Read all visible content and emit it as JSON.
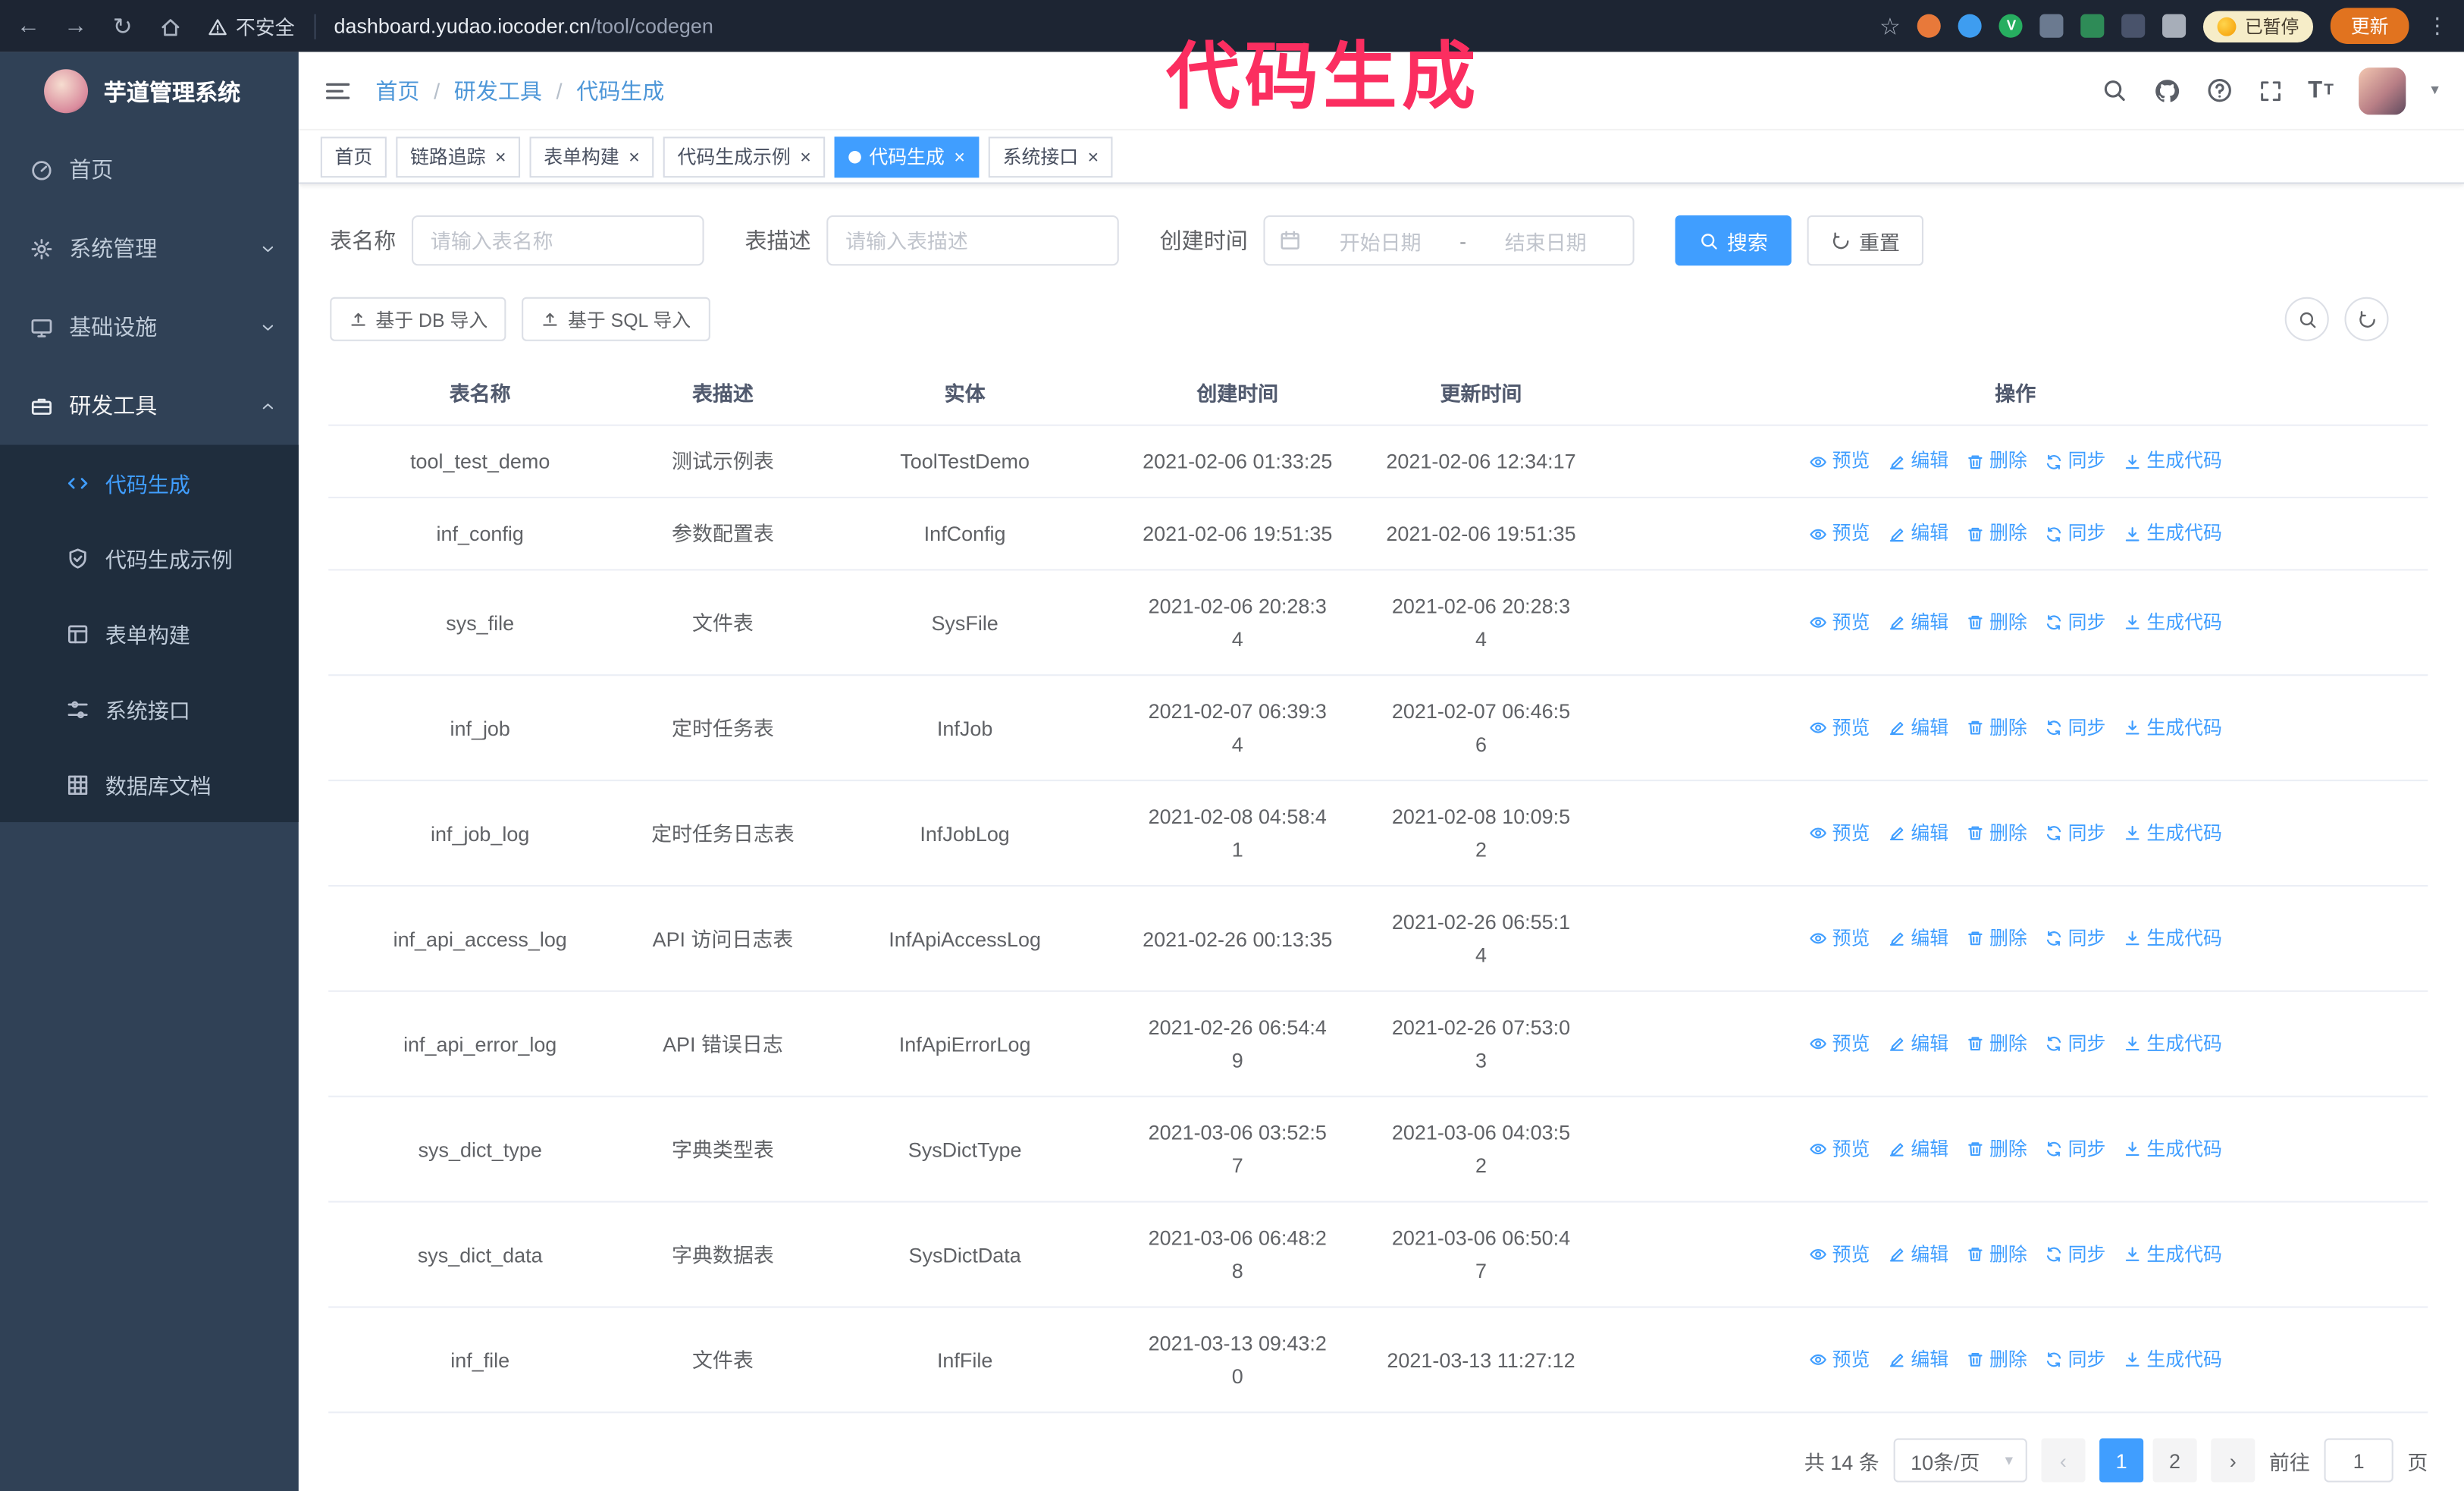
{
  "annotation": {
    "text": "代码生成"
  },
  "icons": {
    "back": "←",
    "forward": "→",
    "reload": "↻",
    "star": "☆",
    "kebab": "⋮",
    "caret": "▾",
    "close": "×",
    "prev": "‹",
    "next": "›"
  },
  "browser": {
    "security_label": "不安全",
    "url_host": "dashboard.yudao.iocoder.cn",
    "url_path": "/tool/codegen",
    "paused_badge": "已暂停",
    "update_label": "更新"
  },
  "sidebar": {
    "logo_title": "芋道管理系统",
    "menu": [
      {
        "label": "首页",
        "icon": "home",
        "kind": "leaf",
        "active": false,
        "expanded": false
      },
      {
        "label": "系统管理",
        "icon": "gear",
        "kind": "parent",
        "active": false,
        "expanded": false
      },
      {
        "label": "基础设施",
        "icon": "monitor",
        "kind": "parent",
        "active": false,
        "expanded": false
      },
      {
        "label": "研发工具",
        "icon": "tools",
        "kind": "parent",
        "active": false,
        "expanded": true,
        "children": [
          {
            "label": "代码生成",
            "icon": "code",
            "active": true
          },
          {
            "label": "代码生成示例",
            "icon": "shield",
            "active": false
          },
          {
            "label": "表单构建",
            "icon": "form",
            "active": false
          },
          {
            "label": "系统接口",
            "icon": "sliders",
            "active": false
          },
          {
            "label": "数据库文档",
            "icon": "grid",
            "active": false
          }
        ]
      }
    ]
  },
  "navbar": {
    "breadcrumb": [
      "首页",
      "研发工具",
      "代码生成"
    ]
  },
  "tags": [
    {
      "label": "首页",
      "closable": false,
      "active": false
    },
    {
      "label": "链路追踪",
      "closable": true,
      "active": false
    },
    {
      "label": "表单构建",
      "closable": true,
      "active": false
    },
    {
      "label": "代码生成示例",
      "closable": true,
      "active": false
    },
    {
      "label": "代码生成",
      "closable": true,
      "active": true
    },
    {
      "label": "系统接口",
      "closable": true,
      "active": false
    }
  ],
  "filters": {
    "table_name_label": "表名称",
    "table_name_placeholder": "请输入表名称",
    "table_desc_label": "表描述",
    "table_desc_placeholder": "请输入表描述",
    "create_time_label": "创建时间",
    "date_start_placeholder": "开始日期",
    "date_separator": "-",
    "date_end_placeholder": "结束日期",
    "search_label": "搜索",
    "reset_label": "重置"
  },
  "toolbar": {
    "import_db": "基于 DB 导入",
    "import_sql": "基于 SQL 导入"
  },
  "table": {
    "columns": [
      "表名称",
      "表描述",
      "实体",
      "创建时间",
      "更新时间",
      "操作"
    ],
    "action_labels": [
      "预览",
      "编辑",
      "删除",
      "同步",
      "生成代码"
    ],
    "rows": [
      {
        "name": "tool_test_demo",
        "desc": "测试示例表",
        "entity": "ToolTestDemo",
        "created": "2021-02-06 01:33:25",
        "updated": "2021-02-06 12:34:17"
      },
      {
        "name": "inf_config",
        "desc": "参数配置表",
        "entity": "InfConfig",
        "created": "2021-02-06 19:51:35",
        "updated": "2021-02-06 19:51:35"
      },
      {
        "name": "sys_file",
        "desc": "文件表",
        "entity": "SysFile",
        "created": "2021-02-06 20:28:3\n4",
        "updated": "2021-02-06 20:28:3\n4"
      },
      {
        "name": "inf_job",
        "desc": "定时任务表",
        "entity": "InfJob",
        "created": "2021-02-07 06:39:3\n4",
        "updated": "2021-02-07 06:46:5\n6"
      },
      {
        "name": "inf_job_log",
        "desc": "定时任务日志表",
        "entity": "InfJobLog",
        "created": "2021-02-08 04:58:4\n1",
        "updated": "2021-02-08 10:09:5\n2"
      },
      {
        "name": "inf_api_access_log",
        "desc": "API 访问日志表",
        "entity": "InfApiAccessLog",
        "created": "2021-02-26 00:13:35",
        "updated": "2021-02-26 06:55:1\n4"
      },
      {
        "name": "inf_api_error_log",
        "desc": "API 错误日志",
        "entity": "InfApiErrorLog",
        "created": "2021-02-26 06:54:4\n9",
        "updated": "2021-02-26 07:53:0\n3"
      },
      {
        "name": "sys_dict_type",
        "desc": "字典类型表",
        "entity": "SysDictType",
        "created": "2021-03-06 03:52:5\n7",
        "updated": "2021-03-06 04:03:5\n2"
      },
      {
        "name": "sys_dict_data",
        "desc": "字典数据表",
        "entity": "SysDictData",
        "created": "2021-03-06 06:48:2\n8",
        "updated": "2021-03-06 06:50:4\n7"
      },
      {
        "name": "inf_file",
        "desc": "文件表",
        "entity": "InfFile",
        "created": "2021-03-13 09:43:2\n0",
        "updated": "2021-03-13 11:27:12"
      }
    ]
  },
  "pagination": {
    "total": "共 14 条",
    "page_size": "10条/页",
    "pages": [
      "1",
      "2"
    ],
    "active_page": "1",
    "goto_label": "前往",
    "goto_value": "1",
    "unit_label": "页"
  }
}
